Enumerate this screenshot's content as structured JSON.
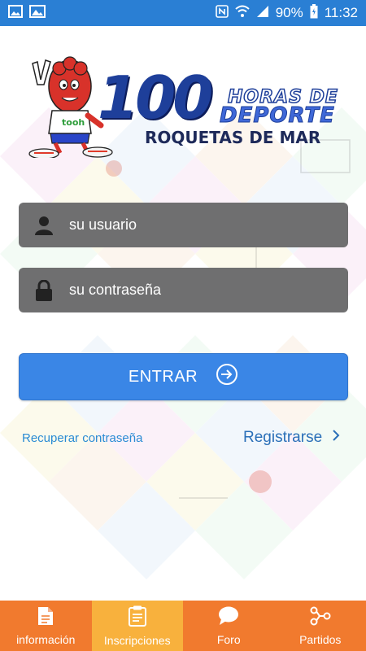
{
  "status_bar": {
    "battery": "90%",
    "time": "11:32",
    "icons": [
      "image-icon",
      "gallery-icon",
      "nfc-icon",
      "wifi-icon",
      "signal-icon",
      "battery-icon"
    ]
  },
  "logo": {
    "number": "100",
    "line1": "HORAS DE",
    "line2": "DEPORTE",
    "line3": "ROQUETAS DE MAR",
    "mascot_shirt_text": "tooh"
  },
  "login": {
    "username_placeholder": "su usuario",
    "password_placeholder": "su contraseña",
    "submit_label": "ENTRAR",
    "recover_label": "Recuperar contraseña",
    "register_label": "Registrarse"
  },
  "bottom_nav": {
    "items": [
      {
        "label": "información",
        "icon": "document-icon",
        "active": false
      },
      {
        "label": "Inscripciones",
        "icon": "clipboard-icon",
        "active": true
      },
      {
        "label": "Foro",
        "icon": "chat-bubble-icon",
        "active": false
      },
      {
        "label": "Partidos",
        "icon": "share-nodes-icon",
        "active": false
      }
    ]
  },
  "colors": {
    "status_bar": "#2a7fd4",
    "input_bg": "#6f6f70",
    "primary_button": "#3a86e6",
    "link": "#2a8bd4",
    "nav_bg": "#f17a2e",
    "nav_active": "#f8b13d",
    "logo_blue": "#1e3f9a"
  }
}
